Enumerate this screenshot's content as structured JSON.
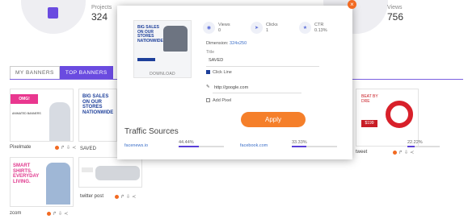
{
  "stats": {
    "projects_label": "Projects",
    "projects_value": "324",
    "views_label": "Views",
    "views_value": "756"
  },
  "tabs": [
    "MY BANNERS",
    "TOP BANNERS"
  ],
  "cards": [
    {
      "name": "Pixelmate",
      "thumb_text": "OMG!",
      "thumb_line1": "GREAT",
      "thumb_line2": "ANIMATED BANNERS",
      "thumb_line3": "for free"
    },
    {
      "name": "SAVED",
      "thumb_text": "BIG SALES ON OUR STORES NATIONWIDE"
    },
    {
      "name": "tweet",
      "thumb_text": "BEAT BY DRE",
      "thumb_price": "$199"
    },
    {
      "name": "zcom",
      "thumb_text": "SMART SHIRTS. EVERYDAY LIVING."
    },
    {
      "name": "twitter post"
    }
  ],
  "modal": {
    "preview_text": "BIG SALES ON OUR STORES NATIONWIDE",
    "download_label": "DOWNLOAD",
    "views_label": "Views",
    "views_value": "0",
    "clicks_label": "Clicks",
    "clicks_value": "1",
    "ctr_label": "CTR",
    "ctr_value": "0.13%",
    "dimension_label": "Dimension:",
    "dimension_value": "324x250",
    "title_label": "Title",
    "title_value": "SAVED",
    "click_line_label": "Click Line",
    "url_value": "http://google.com",
    "add_pixel_label": "Add Pixel",
    "apply_label": "Apply",
    "traffic_title": "Traffic Sources",
    "sources": [
      {
        "name": "facenews.io",
        "pct": "44.44%",
        "fill": 0.44
      },
      {
        "name": "facebook.com",
        "pct": "33.33%",
        "fill": 0.33
      },
      {
        "name": "",
        "pct": "22.22%",
        "fill": 0.22
      }
    ]
  },
  "colors": {
    "accent": "#6a4be0",
    "orange": "#f57f2a",
    "link": "#3c6fc8"
  }
}
